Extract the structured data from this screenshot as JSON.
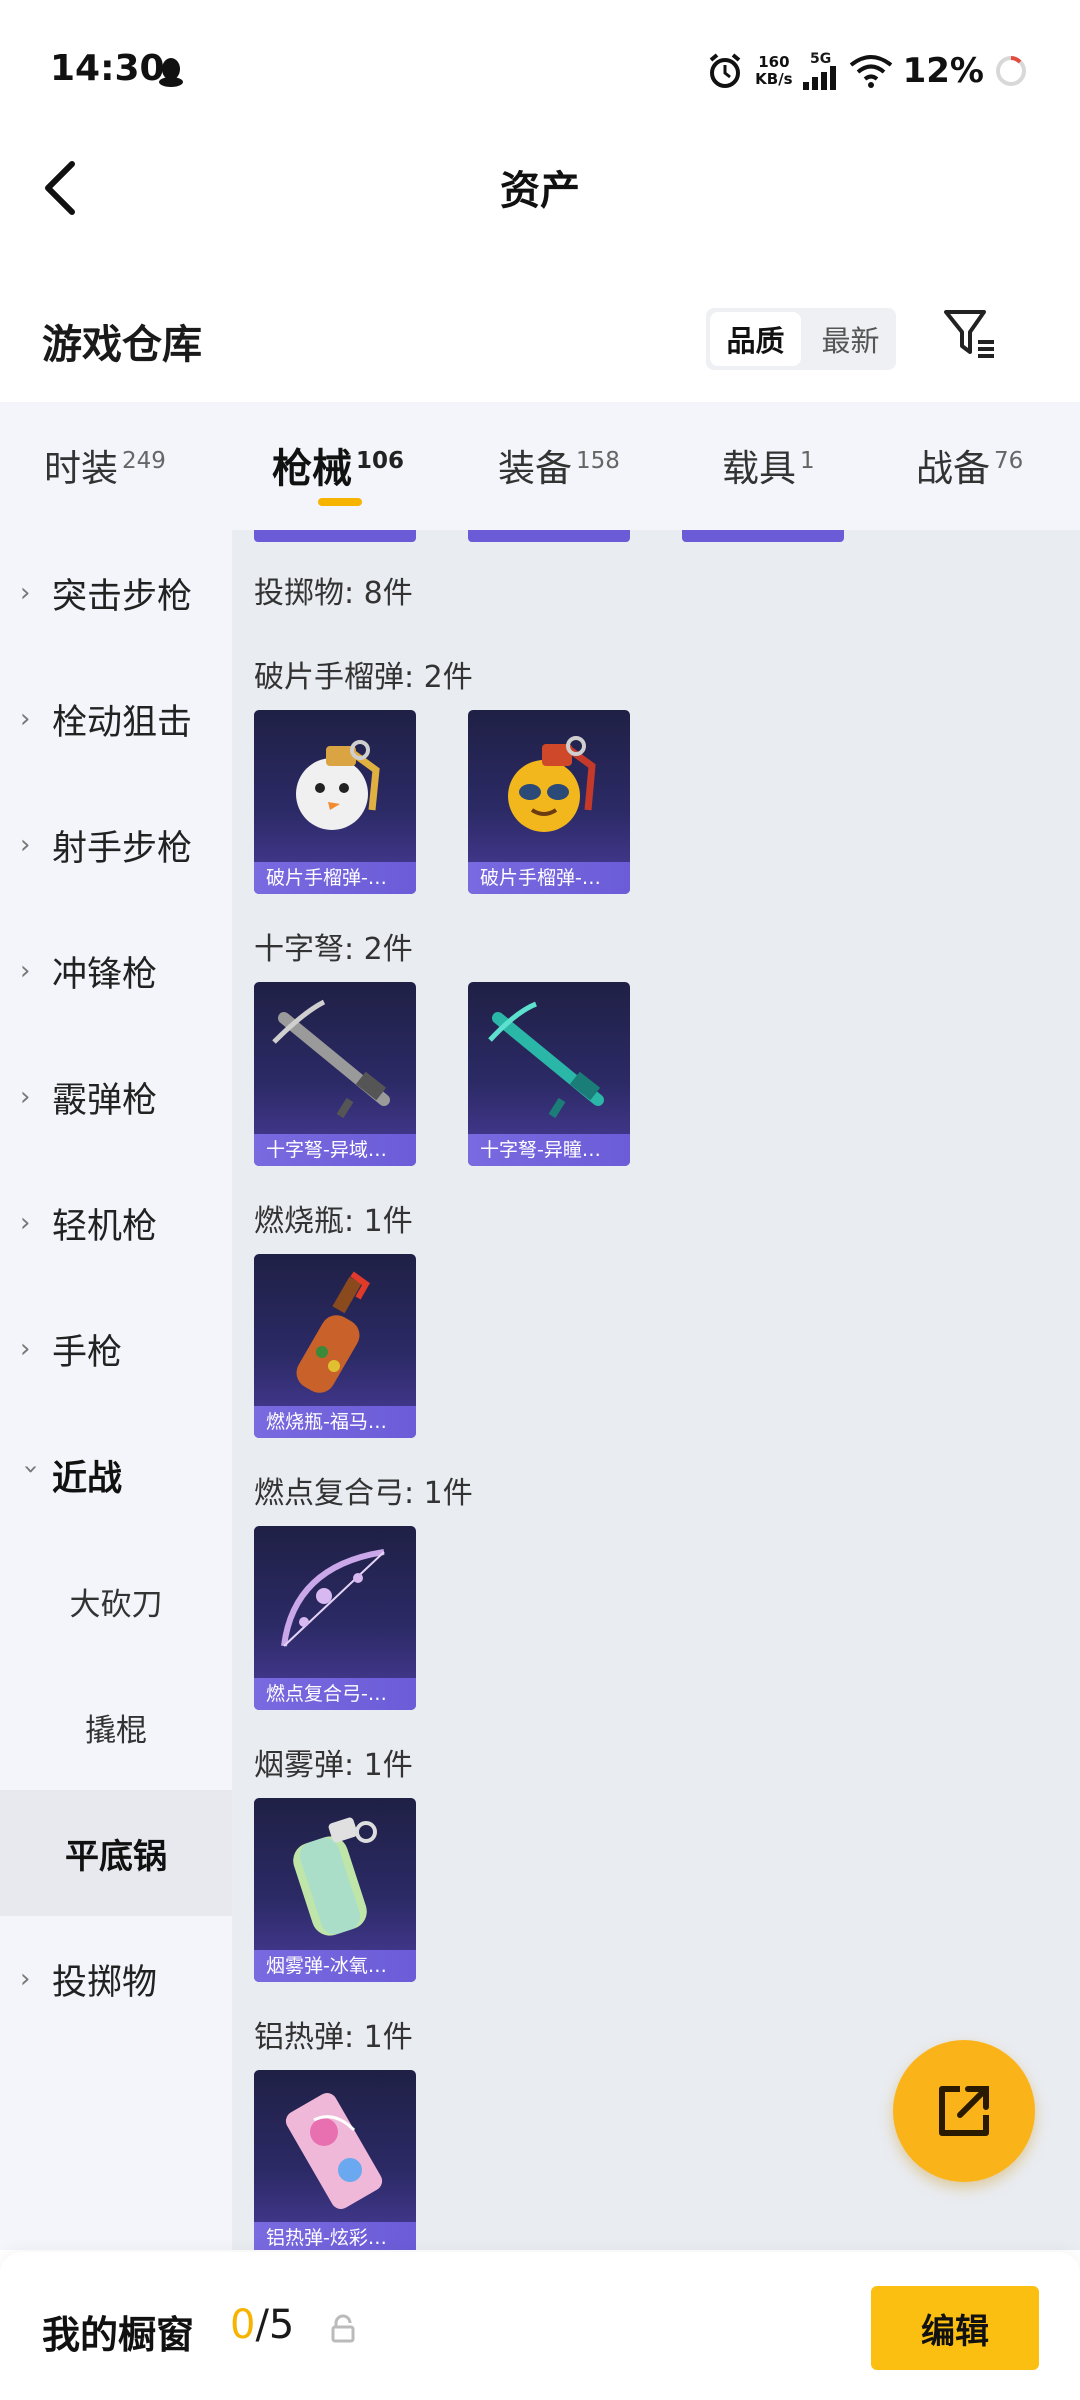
{
  "status_bar": {
    "time": "14:30",
    "speed_value": "160",
    "speed_unit": "KB/s",
    "network": "5G",
    "battery": "12%"
  },
  "header": {
    "title": "资产"
  },
  "warehouse": {
    "title": "游戏仓库",
    "sort_options": [
      "品质",
      "最新"
    ],
    "active_sort": "品质"
  },
  "tabs": [
    {
      "label": "时装",
      "count": "249"
    },
    {
      "label": "枪械",
      "count": "106",
      "active": true
    },
    {
      "label": "装备",
      "count": "158"
    },
    {
      "label": "载具",
      "count": "1"
    },
    {
      "label": "战备",
      "count": "76"
    }
  ],
  "sidebar": {
    "items": [
      {
        "label": "突击步枪"
      },
      {
        "label": "栓动狙击"
      },
      {
        "label": "射手步枪"
      },
      {
        "label": "冲锋枪"
      },
      {
        "label": "霰弹枪"
      },
      {
        "label": "轻机枪"
      },
      {
        "label": "手枪"
      },
      {
        "label": "近战"
      }
    ],
    "sub_items": [
      {
        "label": "大砍刀"
      },
      {
        "label": "撬棍"
      },
      {
        "label": "平底锅"
      }
    ],
    "last_item": {
      "label": "投掷物"
    }
  },
  "content": {
    "summary": "投掷物: 8件",
    "sections": [
      {
        "title": "破片手榴弹: 2件",
        "items": [
          "破片手榴弹-…",
          "破片手榴弹-…"
        ]
      },
      {
        "title": "十字弩: 2件",
        "items": [
          "十字弩-异域…",
          "十字弩-异瞳…"
        ]
      },
      {
        "title": "燃烧瓶: 1件",
        "items": [
          "燃烧瓶-福马…"
        ]
      },
      {
        "title": "燃点复合弓: 1件",
        "items": [
          "燃点复合弓-…"
        ]
      },
      {
        "title": "烟雾弹: 1件",
        "items": [
          "烟雾弹-冰氧…"
        ]
      },
      {
        "title": "铝热弹: 1件",
        "items": [
          "铝热弹-炫彩…"
        ]
      }
    ]
  },
  "bottom_bar": {
    "label": "我的橱窗",
    "current": "0",
    "total": "/5",
    "edit_label": "编辑"
  },
  "colors": {
    "accent": "#f6b300",
    "card_bg": "#2c2a66",
    "card_footer": "#7a6ae0",
    "fab": "#fbb31a"
  }
}
